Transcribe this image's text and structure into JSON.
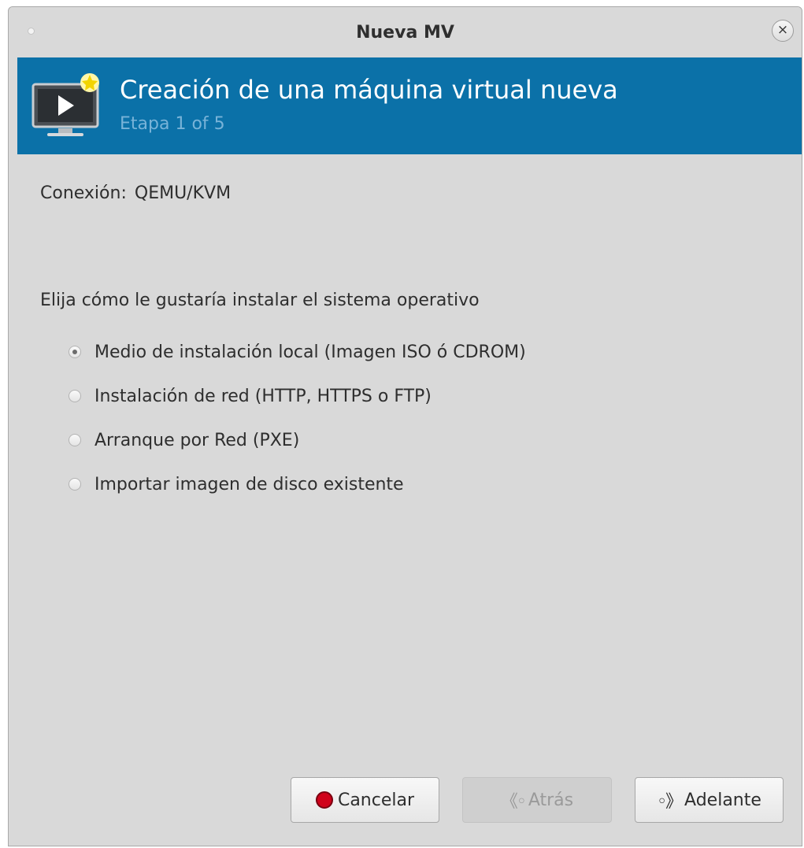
{
  "window": {
    "title": "Nueva MV",
    "close_icon": "×"
  },
  "banner": {
    "title": "Creación de una máquina virtual nueva",
    "subtitle": "Etapa 1 of 5",
    "icon": "monitor-play-icon",
    "accent_color": "#0b71a8"
  },
  "connection": {
    "label": "Conexión:",
    "value": "QEMU/KVM"
  },
  "install": {
    "prompt": "Elija cómo le gustaría instalar el sistema operativo",
    "options": [
      {
        "label": "Medio de instalación local (Imagen ISO ó CDROM)",
        "selected": true
      },
      {
        "label": "Instalación de red (HTTP, HTTPS o FTP)",
        "selected": false
      },
      {
        "label": "Arranque por Red (PXE)",
        "selected": false
      },
      {
        "label": "Importar imagen de disco existente",
        "selected": false
      }
    ]
  },
  "buttons": {
    "cancel": {
      "label": "Cancelar",
      "icon": "stop-icon",
      "enabled": true
    },
    "back": {
      "label": "Atrás",
      "icon": "back-arrow-icon",
      "enabled": false
    },
    "forward": {
      "label": "Adelante",
      "icon": "forward-arrow-icon",
      "enabled": true
    }
  }
}
